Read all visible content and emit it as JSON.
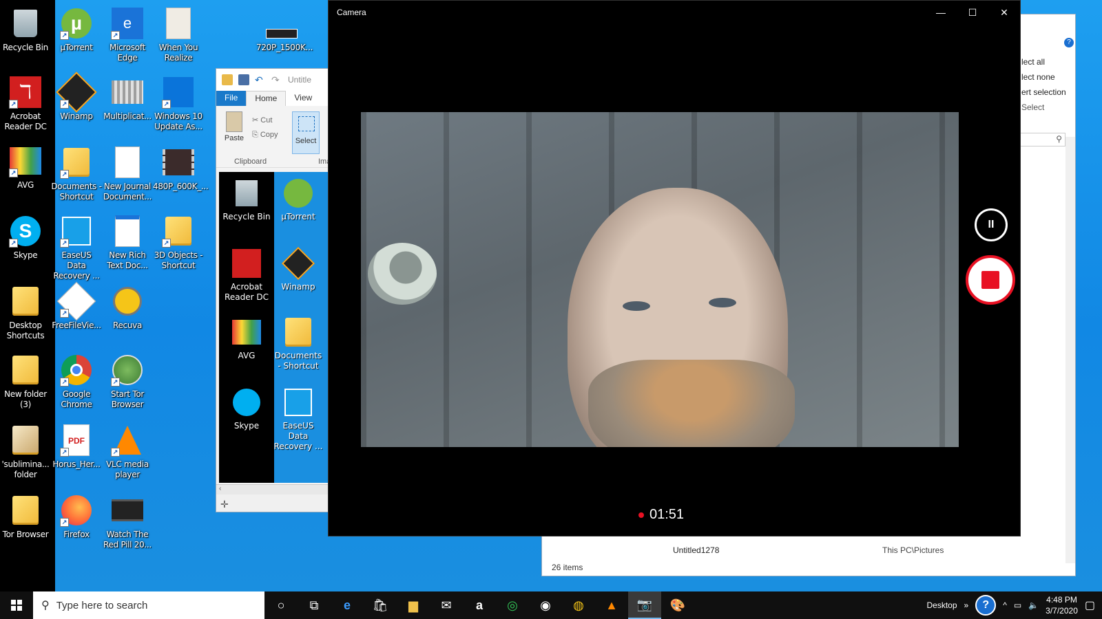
{
  "desktop": {
    "icons": [
      {
        "label": "Recycle Bin"
      },
      {
        "label": "Acrobat Reader DC"
      },
      {
        "label": "AVG"
      },
      {
        "label": "Skype"
      },
      {
        "label": "Desktop Shortcuts"
      },
      {
        "label": "New folder (3)"
      },
      {
        "label": "'sublimina... folder"
      },
      {
        "label": "Tor Browser"
      },
      {
        "label": "µTorrent"
      },
      {
        "label": "Winamp"
      },
      {
        "label": "Documents - Shortcut"
      },
      {
        "label": "EaseUS Data Recovery ..."
      },
      {
        "label": "FreeFileVie..."
      },
      {
        "label": "Google Chrome"
      },
      {
        "label": "Horus_Her..."
      },
      {
        "label": "Firefox"
      },
      {
        "label": "Microsoft Edge"
      },
      {
        "label": "Multiplicat..."
      },
      {
        "label": "New Journal Document..."
      },
      {
        "label": "New Rich Text Doc..."
      },
      {
        "label": "Recuva"
      },
      {
        "label": "Start Tor Browser"
      },
      {
        "label": "VLC media player"
      },
      {
        "label": "Watch The Red Pill 20..."
      },
      {
        "label": "When You Realize"
      },
      {
        "label": "Windows 10 Update As..."
      },
      {
        "label": "480P_600K_..."
      },
      {
        "label": "3D Objects - Shortcut"
      },
      {
        "label": "720P_1500K..."
      }
    ]
  },
  "paint": {
    "title": "Untitle",
    "tabs": {
      "file": "File",
      "home": "Home",
      "view": "View"
    },
    "paste": "Paste",
    "cut": "Cut",
    "copy": "Copy",
    "select": "Select",
    "clipboard_group": "Clipboard",
    "image_group": "Ima",
    "canvas_icons": [
      {
        "label": "Recycle Bin"
      },
      {
        "label": "µTorrent"
      },
      {
        "label": "Acrobat Reader DC"
      },
      {
        "label": "Winamp"
      },
      {
        "label": "AVG"
      },
      {
        "label": "Documents - Shortcut"
      },
      {
        "label": "Skype"
      },
      {
        "label": "EaseUS Data Recovery ..."
      }
    ]
  },
  "explorer": {
    "select_all": "lect all",
    "select_none": "lect none",
    "invert_selection": "ert selection",
    "select_group": "Select",
    "file_row_name": "Untitled1278",
    "file_row_location": "This PC\\Pictures",
    "status": "26 items"
  },
  "camera": {
    "title": "Camera",
    "timer": "01:51",
    "pause_glyph": "II"
  },
  "taskbar": {
    "search_placeholder": "Type here to search",
    "desktop_label": "Desktop",
    "time": "4:48 PM",
    "date": "3/7/2020",
    "accent": "#76b9ed"
  },
  "colors": {
    "desktop_blue": "#1a8fe0",
    "record_red": "#e81123",
    "paint_file_tab": "#1979ca"
  }
}
